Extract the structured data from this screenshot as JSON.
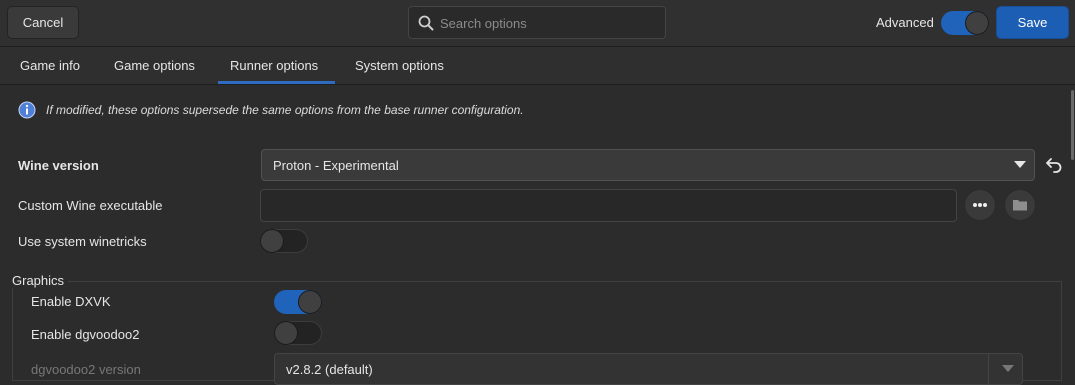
{
  "header": {
    "cancel_label": "Cancel",
    "search_placeholder": "Search options",
    "advanced_label": "Advanced",
    "advanced_on": true,
    "save_label": "Save"
  },
  "tabs": [
    {
      "label": "Game info",
      "active": false
    },
    {
      "label": "Game options",
      "active": false
    },
    {
      "label": "Runner options",
      "active": true
    },
    {
      "label": "System options",
      "active": false
    }
  ],
  "info": {
    "icon": "info-icon",
    "text": "If modified, these options supersede the same options from the base runner configuration."
  },
  "options": {
    "wine_version": {
      "label": "Wine version",
      "value": "Proton - Experimental"
    },
    "custom_wine": {
      "label": "Custom Wine executable",
      "value": ""
    },
    "system_winetricks": {
      "label": "Use system winetricks",
      "on": false
    }
  },
  "graphics": {
    "title": "Graphics",
    "enable_dxvk": {
      "label": "Enable DXVK",
      "on": true
    },
    "enable_dgvoodoo2": {
      "label": "Enable dgvoodoo2",
      "on": false
    },
    "dgvoodoo2_version": {
      "label": "dgvoodoo2 version",
      "value": "v2.8.2 (default)"
    }
  },
  "colors": {
    "accent": "#1f63ba",
    "background": "#2c2c2c"
  }
}
